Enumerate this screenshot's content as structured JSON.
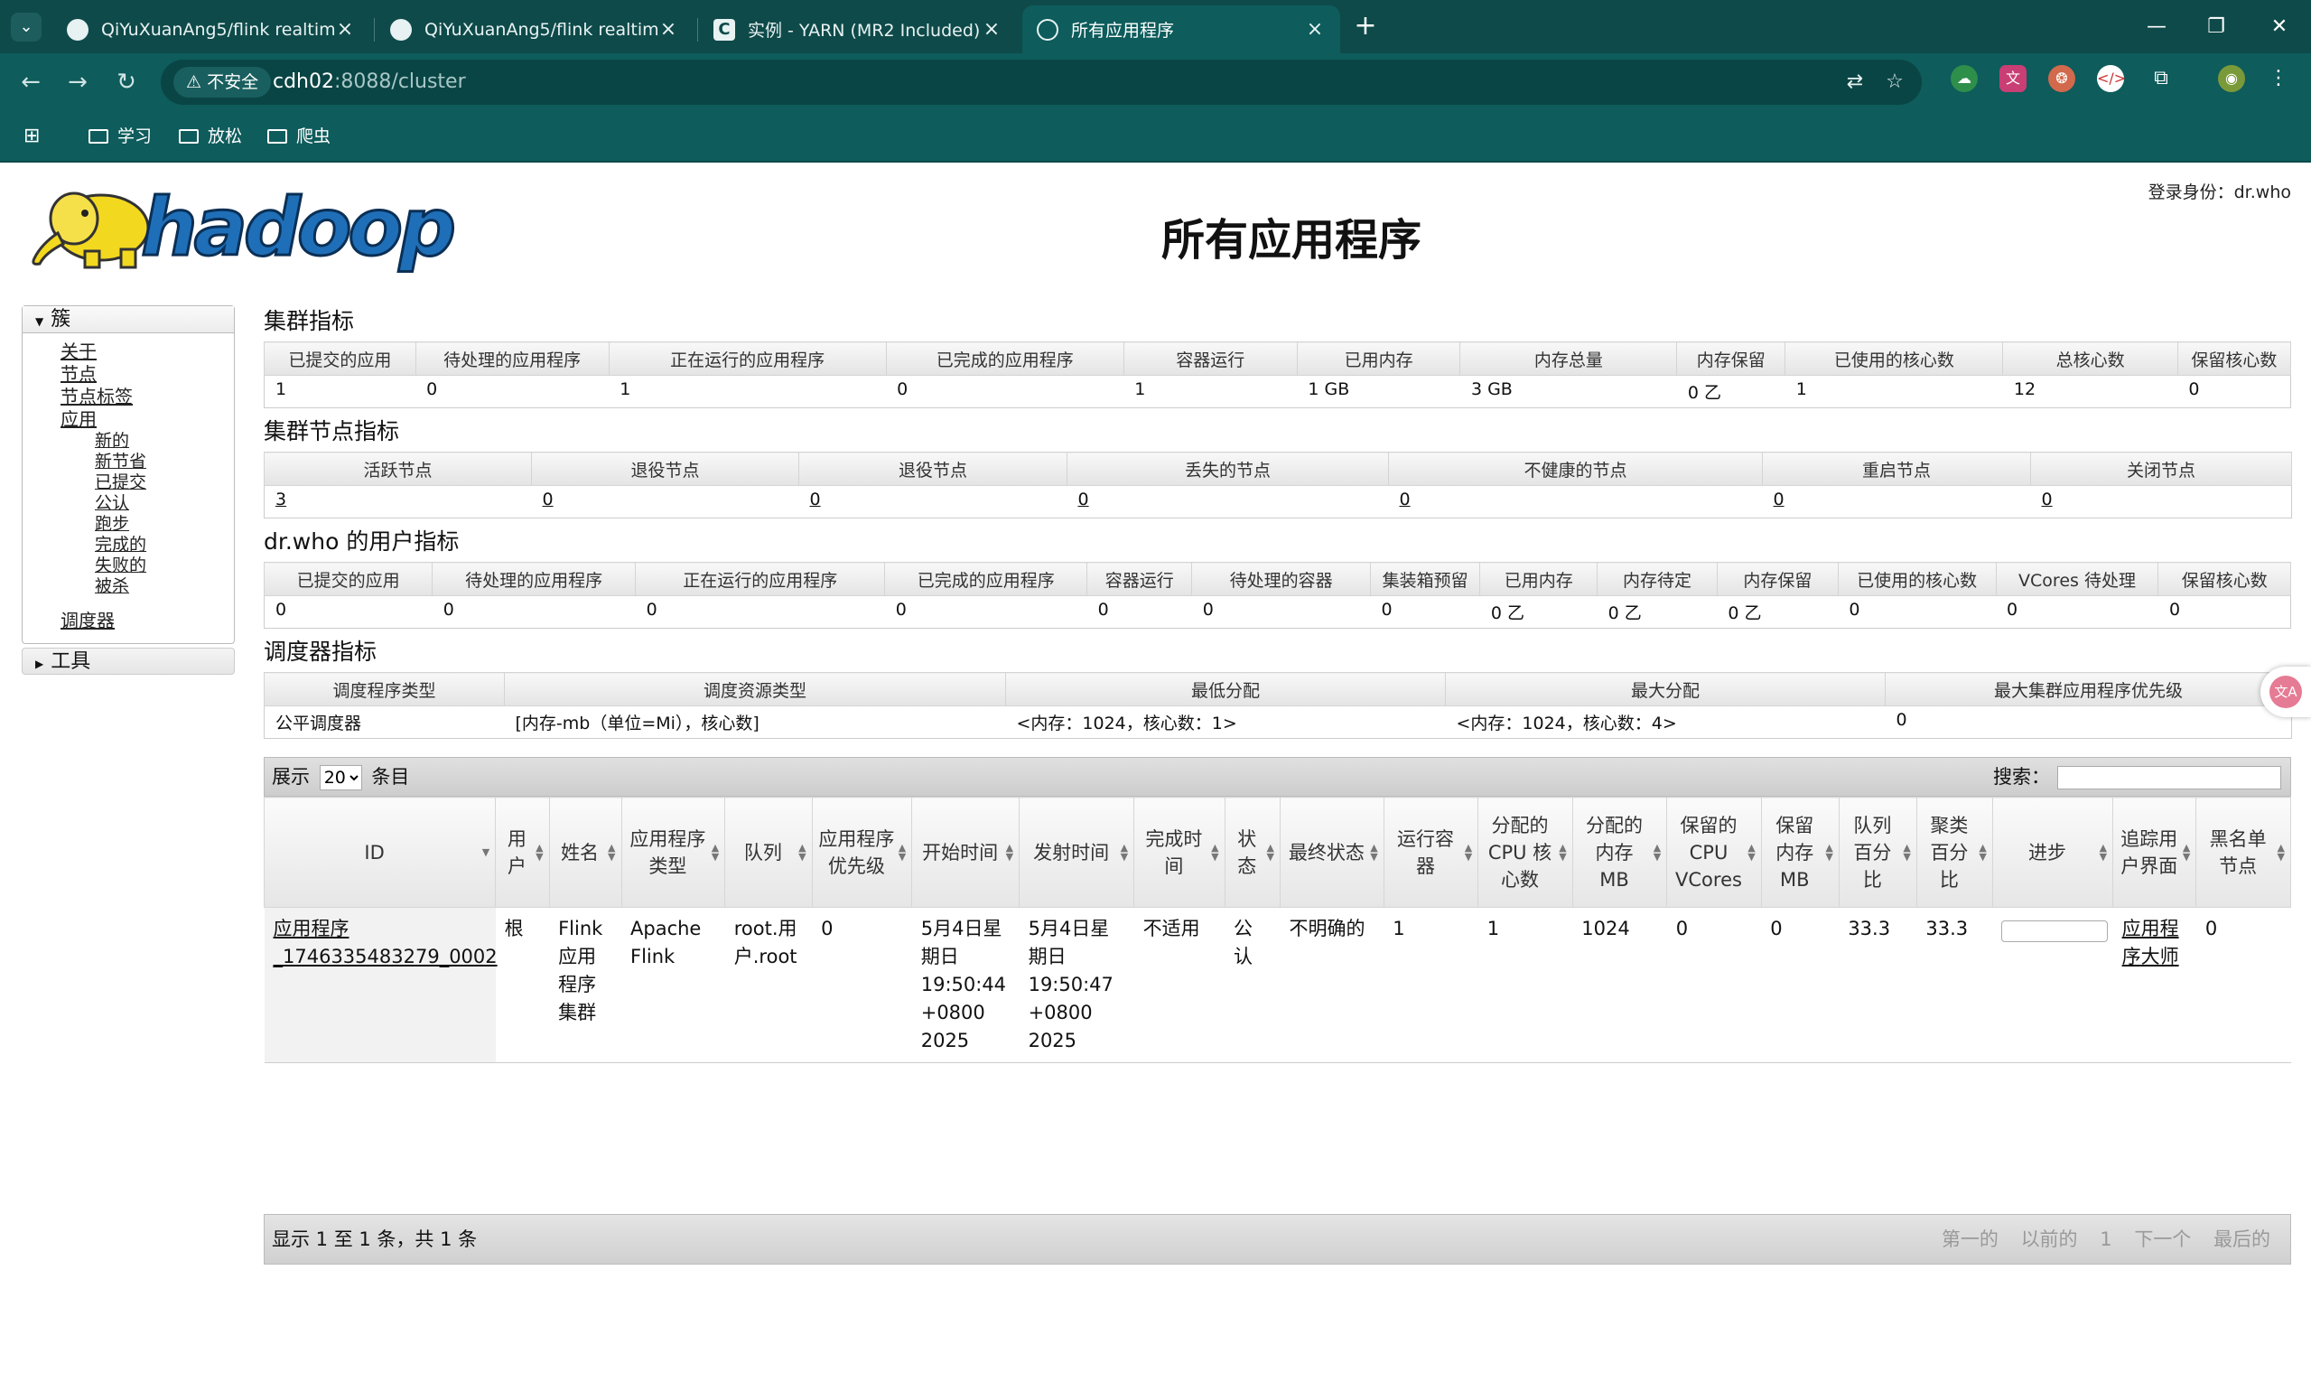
{
  "browser": {
    "tabs": [
      {
        "title": "QiYuXuanAng5/flink realtime",
        "icon": "github-icon"
      },
      {
        "title": "QiYuXuanAng5/flink realtime",
        "icon": "github-icon"
      },
      {
        "title": "实例 - YARN (MR2 Included)",
        "icon": "cloudera-icon"
      },
      {
        "title": "所有应用程序",
        "icon": "globe-icon",
        "active": true
      }
    ],
    "security_label": "不安全",
    "url_host": "cdh02",
    "url_rest": ":8088/cluster",
    "bookmarks": [
      "学习",
      "放松",
      "爬虫"
    ]
  },
  "page": {
    "login": "登录身份：dr.who",
    "title": "所有应用程序",
    "logo_text": "hadoop"
  },
  "sidebar": {
    "cluster_label": "簇",
    "links": [
      "关于",
      "节点",
      "节点标签",
      "应用"
    ],
    "app_states": [
      "新的",
      "新节省",
      "已提交",
      "公认",
      "跑步",
      "完成的",
      "失败的",
      "被杀"
    ],
    "scheduler": "调度器",
    "tools": "工具"
  },
  "cluster_metrics": {
    "title": "集群指标",
    "headers": [
      "已提交的应用",
      "待处理的应用程序",
      "正在运行的应用程序",
      "已完成的应用程序",
      "容器运行",
      "已用内存",
      "内存总量",
      "内存保留",
      "已使用的核心数",
      "总核心数",
      "保留核心数"
    ],
    "values": [
      "1",
      "0",
      "1",
      "0",
      "1",
      "1 GB",
      "3 GB",
      "0 乙",
      "1",
      "12",
      "0"
    ]
  },
  "node_metrics": {
    "title": "集群节点指标",
    "headers": [
      "活跃节点",
      "退役节点",
      "退役节点",
      "丢失的节点",
      "不健康的节点",
      "重启节点",
      "关闭节点"
    ],
    "values": [
      "3",
      "0",
      "0",
      "0",
      "0",
      "0",
      "0"
    ]
  },
  "user_metrics": {
    "title": "dr.who 的用户指标",
    "headers": [
      "已提交的应用",
      "待处理的应用程序",
      "正在运行的应用程序",
      "已完成的应用程序",
      "容器运行",
      "待处理的容器",
      "集装箱预留",
      "已用内存",
      "内存待定",
      "内存保留",
      "已使用的核心数",
      "VCores 待处理",
      "保留核心数"
    ],
    "values": [
      "0",
      "0",
      "0",
      "0",
      "0",
      "0",
      "0",
      "0 乙",
      "0 乙",
      "0 乙",
      "0",
      "0",
      "0"
    ]
  },
  "scheduler_metrics": {
    "title": "调度器指标",
    "headers": [
      "调度程序类型",
      "调度资源类型",
      "最低分配",
      "最大分配",
      "最大集群应用程序优先级"
    ],
    "values": [
      "公平调度器",
      "[内存-mb（单位=Mi），核心数]",
      "<内存：1024，核心数：1>",
      "<内存：1024，核心数：4>",
      "0"
    ]
  },
  "apps_table": {
    "show_label": "展示",
    "page_size": "20",
    "entries_label": "条目",
    "search_label": "搜索：",
    "headers": [
      "ID",
      "用户",
      "姓名",
      "应用程序类型",
      "队列",
      "应用程序优先级",
      "开始时间",
      "发射时间",
      "完成时间",
      "状态",
      "最终状态",
      "运行容器",
      "分配的 CPU 核心数",
      "分配的内存 MB",
      "保留的 CPU VCores",
      "保留内存 MB",
      "队列百分比",
      "聚类百分比",
      "进步",
      "追踪用户界面",
      "黑名单节点"
    ],
    "rows": [
      [
        "应用程序_1746335483279_0002",
        "根",
        "Flink 应用程序集群",
        "Apache Flink",
        "root.用户.root",
        "0",
        "5月4日星期日 19:50:44 +0800 2025",
        "5月4日星期日 19:50:47 +0800 2025",
        "不适用",
        "公认",
        "不明确的",
        "1",
        "1",
        "1024",
        "0",
        "0",
        "33.3",
        "33.3",
        "",
        "应用程序大师",
        "0"
      ]
    ],
    "footer_info": "显示 1 至 1 条，共 1 条",
    "pager": [
      "第一的",
      "以前的",
      "1",
      "下一个",
      "最后的"
    ]
  }
}
